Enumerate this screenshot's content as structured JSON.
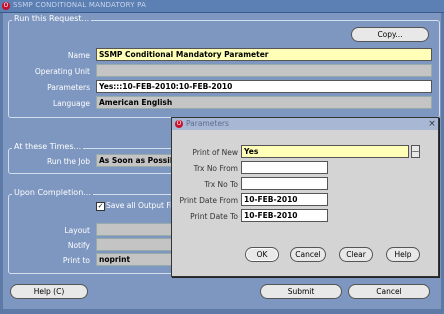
{
  "window": {
    "title": "SSMP CONDITIONAL MANDATORY PA",
    "icon_label": "O"
  },
  "run_request": {
    "group_label": "Run this Request...",
    "copy_button": "Copy...",
    "name_label": "Name",
    "name_value": "SSMP Conditional Mandatory Parameter",
    "operating_unit_label": "Operating Unit",
    "operating_unit_value": "",
    "parameters_label": "Parameters",
    "parameters_value": "Yes:::10-FEB-2010:10-FEB-2010",
    "language_label": "Language",
    "language_value": "American English"
  },
  "at_these_times": {
    "group_label": "At these Times...",
    "run_job_label": "Run the Job",
    "run_job_value": "As Soon as Possible"
  },
  "upon_completion": {
    "group_label": "Upon Completion...",
    "save_output_label": "Save all Output Fil",
    "save_output_checked": true,
    "layout_label": "Layout",
    "notify_label": "Notify",
    "print_to_label": "Print to",
    "print_to_value": "noprint"
  },
  "footer": {
    "help_button": "Help (C)",
    "submit_button": "Submit",
    "cancel_button": "Cancel"
  },
  "parameters_dialog": {
    "title": "Parameters",
    "close_symbol": "×",
    "print_of_new_label": "Print of New",
    "print_of_new_value": "Yes",
    "lov_button": "—",
    "trx_no_from_label": "Trx No From",
    "trx_no_from_value": "",
    "trx_no_to_label": "Trx No To",
    "trx_no_to_value": "",
    "print_date_from_label": "Print Date From",
    "print_date_from_value": "10-FEB-2010",
    "print_date_to_label": "Print Date To",
    "print_date_to_value": "10-FEB-2010",
    "ok_button": "OK",
    "cancel_button": "Cancel",
    "clear_button": "Clear",
    "help_button": "Help"
  },
  "colors": {
    "background": "#5d7aa6",
    "panel": "#7e97c0",
    "required_field": "#ffffb8",
    "dialog": "#d4d4d4",
    "oracle_red": "#c8102e"
  }
}
